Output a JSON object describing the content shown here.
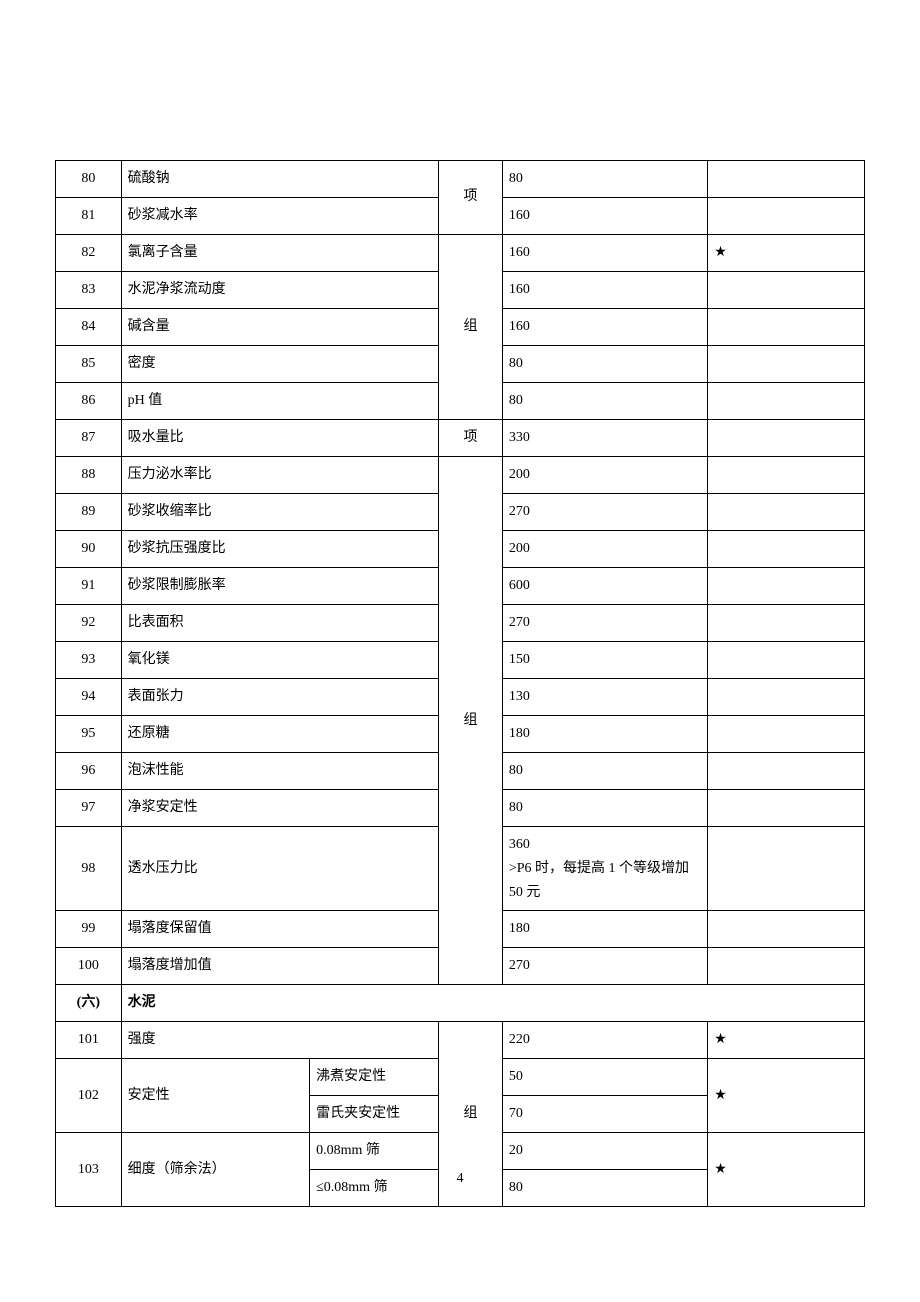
{
  "page_number": "4",
  "section": {
    "num": "(六)",
    "title": "水泥"
  },
  "rows": [
    {
      "n": "80",
      "name": "硫酸钠",
      "unit": "项",
      "val": "80",
      "star": ""
    },
    {
      "n": "81",
      "name": "砂浆减水率",
      "unit": "",
      "val": "160",
      "star": ""
    },
    {
      "n": "82",
      "name": "氯离子含量",
      "unit": "组",
      "val": "160",
      "star": "★"
    },
    {
      "n": "83",
      "name": "水泥净浆流动度",
      "unit": "",
      "val": "160",
      "star": ""
    },
    {
      "n": "84",
      "name": "碱含量",
      "unit": "",
      "val": "160",
      "star": ""
    },
    {
      "n": "85",
      "name": "密度",
      "unit": "",
      "val": "80",
      "star": ""
    },
    {
      "n": "86",
      "name": "pH 值",
      "unit": "",
      "val": "80",
      "star": ""
    },
    {
      "n": "87",
      "name": "吸水量比",
      "unit": "项",
      "val": "330",
      "star": ""
    },
    {
      "n": "88",
      "name": "压力泌水率比",
      "unit": "组",
      "val": "200",
      "star": ""
    },
    {
      "n": "89",
      "name": "砂浆收缩率比",
      "unit": "",
      "val": "270",
      "star": ""
    },
    {
      "n": "90",
      "name": "砂浆抗压强度比",
      "unit": "",
      "val": "200",
      "star": ""
    },
    {
      "n": "91",
      "name": "砂浆限制膨胀率",
      "unit": "",
      "val": "600",
      "star": ""
    },
    {
      "n": "92",
      "name": "比表面积",
      "unit": "",
      "val": "270",
      "star": ""
    },
    {
      "n": "93",
      "name": "氧化镁",
      "unit": "",
      "val": "150",
      "star": ""
    },
    {
      "n": "94",
      "name": "表面张力",
      "unit": "",
      "val": "130",
      "star": ""
    },
    {
      "n": "95",
      "name": "还原糖",
      "unit": "",
      "val": "180",
      "star": ""
    },
    {
      "n": "96",
      "name": "泡沫性能",
      "unit": "",
      "val": "80",
      "star": ""
    },
    {
      "n": "97",
      "name": "净浆安定性",
      "unit": "",
      "val": "80",
      "star": ""
    },
    {
      "n": "98",
      "name": "透水压力比",
      "unit": "",
      "val": "360\n>P6 时，每提高 1 个等级增加 50 元",
      "star": ""
    },
    {
      "n": "99",
      "name": "塌落度保留值",
      "unit": "",
      "val": "180",
      "star": ""
    },
    {
      "n": "100",
      "name": "塌落度增加值",
      "unit": "",
      "val": "270",
      "star": ""
    },
    {
      "n": "101",
      "name": "强度",
      "unit": "组",
      "val": "220",
      "star": "★"
    },
    {
      "n": "102",
      "name": "安定性",
      "sub1": "沸煮安定性",
      "sub2": "雷氏夹安定性",
      "val1": "50",
      "val2": "70",
      "star": "★"
    },
    {
      "n": "103",
      "name": "细度（筛余法）",
      "sub1": "0.08mm 筛",
      "sub2": "≤0.08mm 筛",
      "val1": "20",
      "val2": "80",
      "star": "★"
    }
  ]
}
